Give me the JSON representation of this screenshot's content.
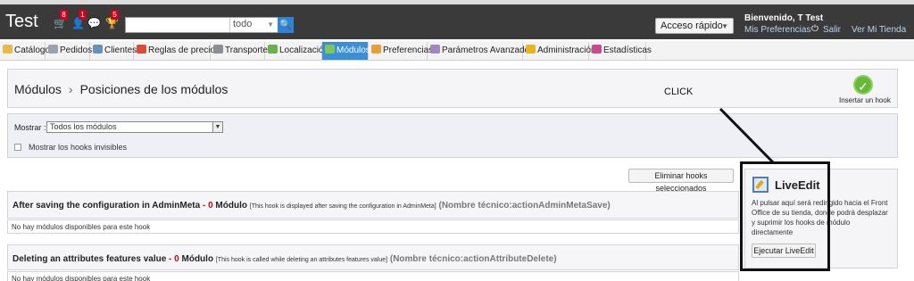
{
  "header": {
    "title": "Test",
    "badges": [
      "8",
      "1",
      "5"
    ],
    "search": {
      "value": "",
      "scope": "todo"
    },
    "quick_access": "Acceso rápido",
    "welcome": "Bienvenido, T Test",
    "preferences_link": "Mis Preferencias",
    "logout_link": "Salir",
    "store_link": "Ver Mi Tienda"
  },
  "tabs": [
    {
      "label": "Catálogo",
      "icon": "folder-icon",
      "color": "#e7b84a"
    },
    {
      "label": "Pedidos",
      "icon": "orders-icon",
      "color": "#9aa3ad"
    },
    {
      "label": "Clientes",
      "icon": "customers-icon",
      "color": "#6a8fbd"
    },
    {
      "label": "Reglas de precios",
      "icon": "price-rules-icon",
      "color": "#d94b3a"
    },
    {
      "label": "Transporte",
      "icon": "truck-icon",
      "color": "#8a8f96"
    },
    {
      "label": "Localización",
      "icon": "globe-icon",
      "color": "#6ab04c"
    },
    {
      "label": "Módulos",
      "icon": "modules-icon",
      "color": "#7ac85a"
    },
    {
      "label": "Preferencias",
      "icon": "preferences-icon",
      "color": "#e3a13a"
    },
    {
      "label": "Parámetros Avanzados",
      "icon": "wrench-icon",
      "color": "#9f86c0"
    },
    {
      "label": "Administración",
      "icon": "key-icon",
      "color": "#e6b422"
    },
    {
      "label": "Estadísticas",
      "icon": "stats-icon",
      "color": "#c94a8e"
    }
  ],
  "breadcrumb": {
    "parent": "Módulos",
    "separator": "›",
    "current": "Posiciones de los módulos"
  },
  "annotation": "CLICK",
  "insert_hook": "Insertar un hook",
  "filter": {
    "label": "Mostrar :",
    "selected": "Todos los módulos",
    "show_invisible": "Mostrar los hooks invisibles"
  },
  "delete_button": "Eliminar hooks seleccionados",
  "hooks": [
    {
      "name": "After saving the configuration in AdminMeta",
      "dash": " - ",
      "count": "0",
      "count_label": " Módulo",
      "description": "[This hook is displayed after saving the configuration in AdminMeta]",
      "technical": "(Nombre técnico:actionAdminMetaSave)",
      "empty": "No hay módulos disponibles para este hook"
    },
    {
      "name": "Deleting an attributes features value",
      "dash": " - ",
      "count": "0",
      "count_label": " Módulo",
      "description": "[This hook is called while deleting an attributes features value]",
      "technical": "(Nombre técnico:actionAttributeDelete)",
      "empty": "No hay módulos disponibles para este hook"
    }
  ],
  "liveedit": {
    "title": "LiveEdit",
    "text": "Al pulsar aquí será redirigido hacia el Front Office de su tienda, donde podrá desplazar y suprimir los hooks de módulo directamente",
    "button": "Ejecutar LiveEdit"
  }
}
